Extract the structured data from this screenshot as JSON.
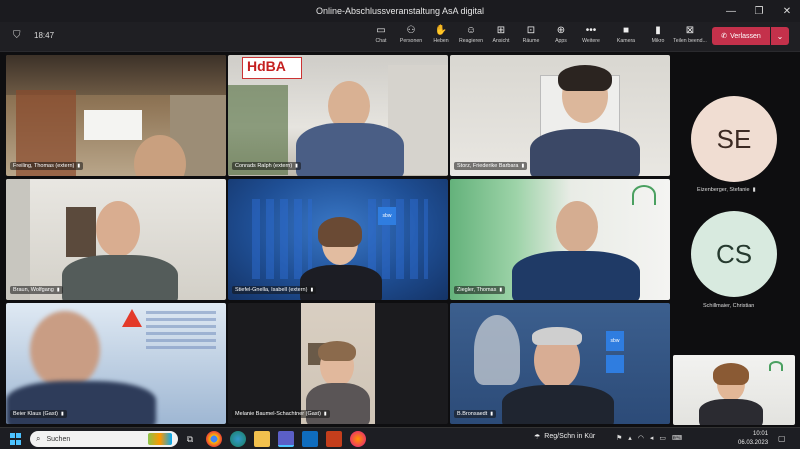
{
  "window": {
    "title": "Online-Abschlussveranstaltung AsA digital"
  },
  "toolbar": {
    "timer": "18:47",
    "buttons": [
      {
        "label": "Chat",
        "icon": "chat-icon",
        "glyph": "▭"
      },
      {
        "label": "Personen",
        "icon": "people-icon",
        "glyph": "⚇"
      },
      {
        "label": "Heben",
        "icon": "raise-hand-icon",
        "glyph": "✋"
      },
      {
        "label": "Reagieren",
        "icon": "react-icon",
        "glyph": "☺"
      },
      {
        "label": "Ansicht",
        "icon": "view-icon",
        "glyph": "⊞"
      },
      {
        "label": "Räume",
        "icon": "rooms-icon",
        "glyph": "⊡"
      },
      {
        "label": "Apps",
        "icon": "apps-icon",
        "glyph": "⊕"
      },
      {
        "label": "Weitere",
        "icon": "more-icon",
        "glyph": "•••"
      }
    ],
    "devices": [
      {
        "label": "Kamera",
        "icon": "camera-icon",
        "glyph": "■"
      },
      {
        "label": "Mikro",
        "icon": "microphone-icon",
        "glyph": "▮"
      },
      {
        "label": "Teilen beend...",
        "icon": "share-screen-icon",
        "glyph": "⊠"
      }
    ],
    "leave_label": "Verlassen"
  },
  "participants": [
    {
      "name": "Freiling, Thomas (extern)"
    },
    {
      "name": "Conrads Ralph (extern)",
      "logo": "HdBA"
    },
    {
      "name": "Storz, Friederike Barbara"
    },
    {
      "name": "Braun, Wolfgang"
    },
    {
      "name": "Stiefel-Gnella, Isabell (extern)"
    },
    {
      "name": "Ziegler, Thomas"
    },
    {
      "name": "Beier Klaus (Gast)"
    },
    {
      "name": "Melanie Baumel-Schachtner (Gast)"
    },
    {
      "name": "B.Bronsaedt"
    }
  ],
  "side_participants": [
    {
      "initials": "SE",
      "name": "Eizenberger, Stefanie",
      "color": "#f0ddd2"
    },
    {
      "initials": "CS",
      "name": "Schillmaier, Christian",
      "color": "#d8eadf"
    }
  ],
  "taskbar": {
    "search_label": "Suchen",
    "weather": "Reg/Schn in Kür",
    "time": "10:01",
    "date": "06.03.2023"
  }
}
